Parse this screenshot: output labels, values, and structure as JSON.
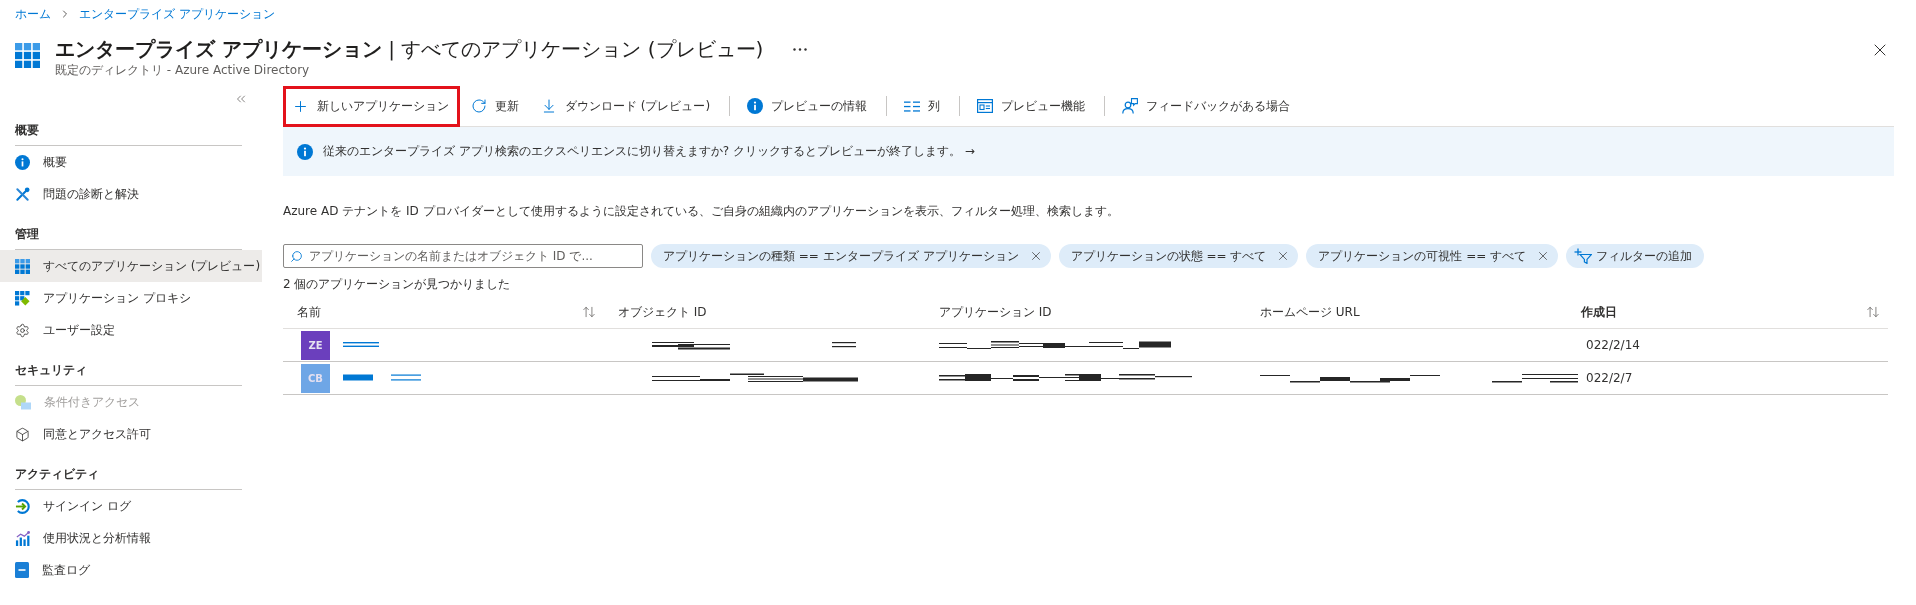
{
  "breadcrumb": [
    {
      "label": "ホーム"
    },
    {
      "label": "エンタープライズ アプリケーション"
    }
  ],
  "header": {
    "title": "**エンタープライズ アプリケーション** | すべてのアプリケーション (プレビュー)",
    "subtitle": "既定のディレクトリ - Azure Active Directory"
  },
  "sidebar": {
    "sections": [
      {
        "title": "概要",
        "items": [
          {
            "kind": "info",
            "label": "概要",
            "selected": false,
            "disabled": false
          },
          {
            "kind": "tools",
            "label": "問題の診断と解決",
            "selected": false,
            "disabled": false
          }
        ]
      },
      {
        "title": "管理",
        "items": [
          {
            "kind": "grid",
            "label": "すべてのアプリケーション (プレビュー)",
            "selected": true,
            "disabled": false
          },
          {
            "kind": "proxy",
            "label": "アプリケーション プロキシ",
            "selected": false,
            "disabled": false
          },
          {
            "kind": "gear",
            "label": "ユーザー設定",
            "selected": false,
            "disabled": false
          }
        ]
      },
      {
        "title": "セキュリティ",
        "items": [
          {
            "kind": "conditional",
            "label": "条件付きアクセス",
            "selected": false,
            "disabled": true
          },
          {
            "kind": "cube",
            "label": "同意とアクセス許可",
            "selected": false,
            "disabled": false
          }
        ]
      },
      {
        "title": "アクティビティ",
        "items": [
          {
            "kind": "signin",
            "label": "サインイン ログ",
            "selected": false,
            "disabled": false
          },
          {
            "kind": "usage",
            "label": "使用状況と分析情報",
            "selected": false,
            "disabled": false
          },
          {
            "kind": "audit",
            "label": "監査ログ",
            "selected": false,
            "disabled": false
          }
        ]
      }
    ]
  },
  "toolbar": {
    "groups": [
      [
        {
          "kind": "add",
          "label": "新しいアプリケーション",
          "highlighted": true
        },
        {
          "kind": "refresh",
          "label": "更新",
          "highlighted": false
        },
        {
          "kind": "download",
          "label": "ダウンロード (プレビュー)",
          "highlighted": false
        }
      ],
      [
        {
          "kind": "info",
          "label": "プレビューの情報",
          "highlighted": false
        }
      ],
      [
        {
          "kind": "columns",
          "label": "列",
          "highlighted": false
        }
      ],
      [
        {
          "kind": "preview",
          "label": "プレビュー機能",
          "highlighted": false
        }
      ],
      [
        {
          "kind": "feedback",
          "label": "フィードバックがある場合",
          "highlighted": false
        }
      ]
    ]
  },
  "banner": {
    "message": "従来のエンタープライズ アプリ検索のエクスペリエンスに切り替えますか? クリックするとプレビューが終了します。 →"
  },
  "description": "Azure AD テナントを ID プロバイダーとして使用するように設定されている、ご自身の組織内のアプリケーションを表示、フィルター処理、検索します。",
  "search": {
    "placeholder": "アプリケーションの名前またはオブジェクト ID で..."
  },
  "filters": [
    {
      "kind": "filter",
      "label": "アプリケーションの種類 == エンタープライズ アプリケーション"
    },
    {
      "kind": "filter",
      "label": "アプリケーションの状態 == すべて"
    },
    {
      "kind": "filter",
      "label": "アプリケーションの可視性 == すべて"
    },
    {
      "kind": "add",
      "label": "フィルターの追加"
    }
  ],
  "result_count": "2 個のアプリケーションが見つかりました",
  "table": {
    "columns": [
      {
        "label": "名前",
        "sortable": true,
        "sorted": false
      },
      {
        "label": "オブジェクト ID",
        "sortable": false,
        "sorted": false
      },
      {
        "label": "アプリケーション ID",
        "sortable": false,
        "sorted": false
      },
      {
        "label": "ホームページ URL",
        "sortable": false,
        "sorted": false
      },
      {
        "label": "作成日",
        "sortable": true,
        "sorted": true
      }
    ],
    "rows": [
      {
        "initials": "ZE",
        "color": "#6b3fbd",
        "name_redacted": true,
        "object_id_redacted": true,
        "application_id_redacted": true,
        "homepage_url_redacted": false,
        "created": "022/2/14"
      },
      {
        "initials": "CB",
        "color": "#6ea6e6",
        "name_redacted": true,
        "object_id_redacted": true,
        "application_id_redacted": true,
        "homepage_url_redacted": true,
        "created": "022/2/7"
      }
    ]
  }
}
